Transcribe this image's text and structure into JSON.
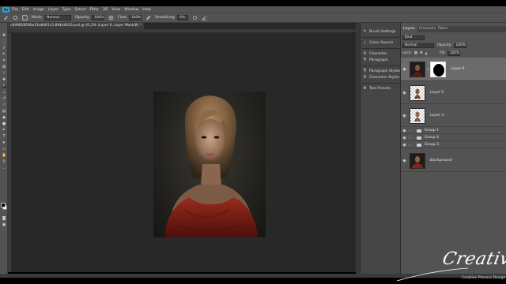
{
  "menubar": {
    "logo": "Ps",
    "items": [
      "File",
      "Edit",
      "Image",
      "Layer",
      "Type",
      "Select",
      "Filter",
      "3D",
      "View",
      "Window",
      "Help"
    ]
  },
  "options": {
    "mode_label": "Mode:",
    "mode_value": "Normal",
    "opacity_label": "Opacity:",
    "opacity_value": "100%",
    "flow_label": "Flow:",
    "flow_value": "100%",
    "smoothing_label": "Smoothing:",
    "smoothing_value": "0%"
  },
  "document": {
    "tab_title": "c849818580e31a8461c5,89444020.psd @ 41,2% (Layer 6, Layer Mask/8) *"
  },
  "mini_panel": {
    "items": [
      "Brush Settings",
      "Clone Source",
      "Character",
      "Paragraph",
      "Paragraph Styles",
      "Character Styles",
      "Tool Presets"
    ]
  },
  "layers_panel": {
    "tabs": [
      "Layers",
      "Channels",
      "Paths"
    ],
    "filter_value": "Kind",
    "blend_mode": "Normal",
    "opacity_label": "Opacity:",
    "opacity_value": "100%",
    "lock_label": "Lock:",
    "fill_label": "Fill:",
    "fill_value": "100%",
    "layers": [
      {
        "name": "Layer 6",
        "kind": "photo-mask",
        "selected": true
      },
      {
        "name": "Layer 5",
        "kind": "transparent"
      },
      {
        "name": "Layer 4",
        "kind": "transparent"
      },
      {
        "name": "Group 1",
        "kind": "group"
      },
      {
        "name": "Group 4",
        "kind": "group"
      },
      {
        "name": "Group 3",
        "kind": "group"
      },
      {
        "name": "Background",
        "kind": "photo"
      }
    ]
  },
  "watermark": {
    "script": "Creative",
    "subtitle": "Creative Process Design"
  },
  "colors": {
    "ui_dark": "#282828",
    "ui_mid": "#535353",
    "accent": "#26a0da",
    "dress_red": "#8a2016"
  }
}
